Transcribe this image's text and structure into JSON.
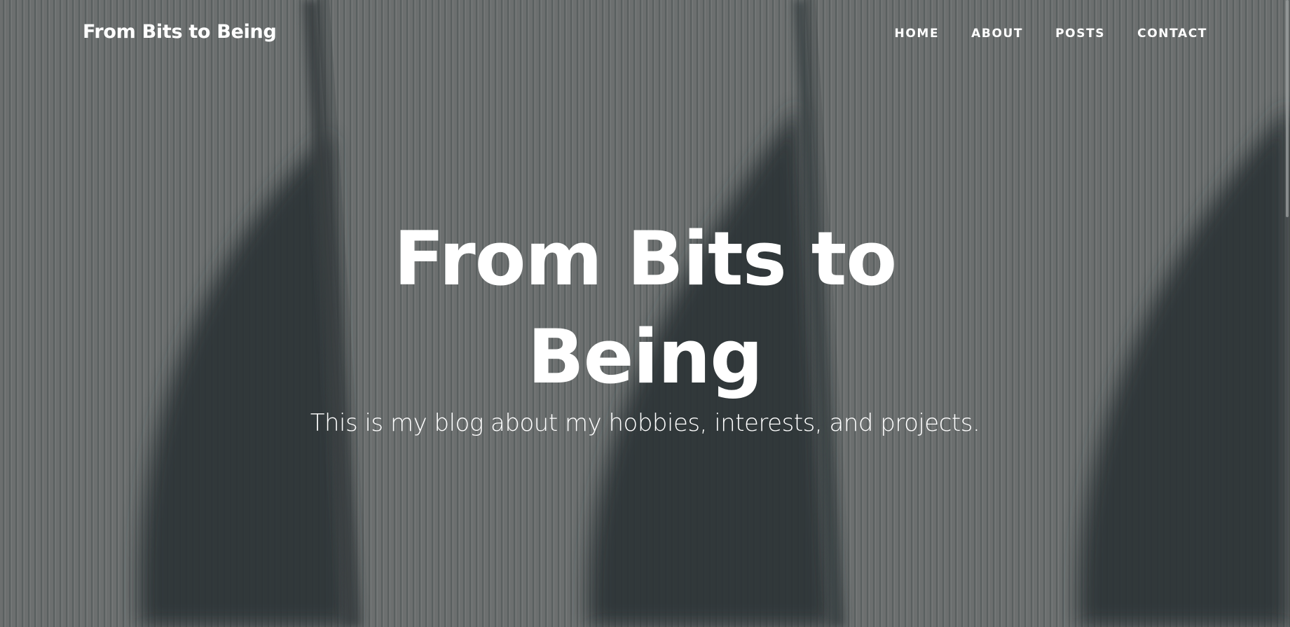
{
  "navbar": {
    "brand": "From Bits to Being",
    "links": [
      {
        "label": "HOME"
      },
      {
        "label": "ABOUT"
      },
      {
        "label": "POSTS"
      },
      {
        "label": "CONTACT"
      }
    ]
  },
  "hero": {
    "title": "From Bits to Being",
    "subtitle": "This is my blog about my hobbies, interests, and projects."
  },
  "colors": {
    "text": "#ffffff",
    "background_gray": "#6f7272",
    "shadow_dark": "#343a3c"
  }
}
